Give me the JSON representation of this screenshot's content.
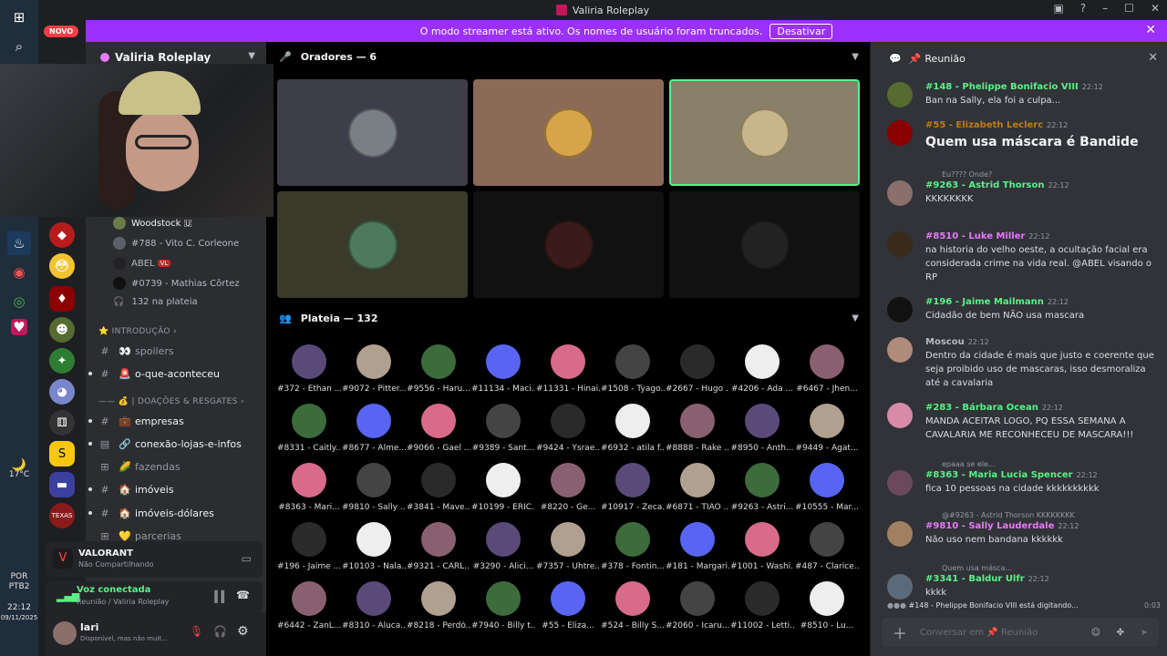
{
  "titlebar": {
    "title": "Valiria Roleplay"
  },
  "banner": {
    "text": "O modo streamer está ativo. Os nomes de usuário foram truncados.",
    "button": "Desativar"
  },
  "rail": {
    "new_badge": "NOVO"
  },
  "taskbar": {
    "temp": "17°C",
    "lang": "POR",
    "lang2": "PTB2",
    "time": "22:12",
    "date": "09/11/2025"
  },
  "server": {
    "name": "Valiria Roleplay"
  },
  "voice_users": [
    "Woodstock 🇺",
    "#788 - Vito C. Corleone",
    "ABEL",
    "#0739 - Mathias Côrtez"
  ],
  "voice_count": "132 na plateia",
  "categories": {
    "intro": "INTRODUÇÃO",
    "doacoes": "| DOAÇÕES & RESGATES"
  },
  "channels": [
    {
      "label": "spoilers",
      "emoji": "👀"
    },
    {
      "label": "o-que-aconteceu",
      "emoji": "🚨"
    },
    {
      "label": "empresas",
      "emoji": "💼"
    },
    {
      "label": "conexão-lojas-e-infos",
      "emoji": "🔗"
    },
    {
      "label": "fazendas",
      "emoji": "🌽"
    },
    {
      "label": "imóveis",
      "emoji": "🏠"
    },
    {
      "label": "imóveis-dólares",
      "emoji": "🏠"
    },
    {
      "label": "parcerias",
      "emoji": "💛"
    }
  ],
  "activity": {
    "title": "VALORANT",
    "sub": "Não Compartilhando"
  },
  "voice": {
    "status": "Voz conectada",
    "sub": "Reunião / Valiria Roleplay"
  },
  "user": {
    "name": "lari",
    "status": "Disponível, mas não muit..."
  },
  "stage": {
    "speakers_title": "Oradores — 6",
    "audience_title": "Plateia — 132"
  },
  "speakers": [
    {
      "bg": "#3e3d4a",
      "pic": "#7a7f86"
    },
    {
      "bg": "#8b6a57",
      "pic": "#d6a54a"
    },
    {
      "bg": "#8a7f68",
      "pic": "#c9b58a"
    },
    {
      "bg": "#3a3a2b",
      "pic": "#4d7a5c"
    },
    {
      "bg": "#111",
      "pic": "#3a1a1a"
    },
    {
      "bg": "#111",
      "pic": "#222"
    }
  ],
  "audience": [
    [
      "#372 - Ethan ...",
      "#9072 - Pitter...",
      "#9556 - Haru...",
      "#11134 - Maci...",
      "#11331 - Hinai...",
      "#1508 - Tyago...",
      "#2667 - Hugo ...",
      "#4206 - Ada ...",
      "#6467 - Jhen..."
    ],
    [
      "#8331 - Caitly...",
      "#8677 - Alme...",
      "#9066 - Gael ...",
      "#9389 - Sant...",
      "#9424 - Ysrae...",
      "#6932 - atila f...",
      "#8888 - Rake ...",
      "#8950 - Anth...",
      "#9449 - Agat..."
    ],
    [
      "#8363 - Mari...",
      "#9810 - Sally ...",
      "#3841 - Mave...",
      "#10199 - ERIC...",
      "#8220 - Ge...",
      "#10917 - Zeca...",
      "#6871 - TIAO ...",
      "#9263 - Astri...",
      "#10555 - Mar..."
    ],
    [
      "#196 - Jaime ...",
      "#10103 - Nala...",
      "#9321 - CARL...",
      "#3290 - Alici...",
      "#7357 - Uhtre...",
      "#378 - Fontin...",
      "#181 - Margari...",
      "#1001 - Washi...",
      "#487 - Clarice..."
    ],
    [
      "#6442 - ZanL...",
      "#8310 - Aluca...",
      "#8218 - Perdó...",
      "#7940 - Billy t...",
      "#55 - Eliza...",
      "#524 - Billy S...",
      "#2060 - Icaru...",
      "#11002 - Letti...",
      "#8510 - Lu..."
    ]
  ],
  "chat": {
    "title": "Reunião",
    "messages": [
      {
        "name": "#148 - Phelippe Bonifacio VIII",
        "time": "22:12",
        "text": "Ban na Sally, ela foi a culpa...",
        "color": "#57f287"
      },
      {
        "name": "#55 - Elizabeth Leclerc",
        "time": "22:12",
        "text": "Quem usa máscara é Bandide",
        "color": "#c27c0e"
      },
      {
        "reply": "Eu???? Onde?",
        "name": "#9263 - Astrid Thorson",
        "time": "22:12",
        "text": "KKKKKKKK",
        "color": "#57f287"
      },
      {
        "name": "#8510 - Luke Miller",
        "time": "22:12",
        "text": "na historia do velho oeste, a ocultação facial era considerada crime na vida real. @ABEL visando o RP",
        "color": "#e879f9"
      },
      {
        "name": "#196 - Jaime Mailmann",
        "time": "22:12",
        "text": "Cidadão de bem NÃO usa mascara",
        "color": "#57f287"
      },
      {
        "name": "Moscou",
        "time": "22:12",
        "text": "Dentro da cidade é mais que justo e coerente que seja proibido uso de mascaras, isso desmoraliza até a cavalaria",
        "color": "#b5bac1"
      },
      {
        "name": "#283 - Bárbara Ocean",
        "time": "22:12",
        "text": "MANDA ACEITAR LOGO, PQ ESSA SEMANA A CAVALARIA ME RECONHECEU DE MASCARA!!!",
        "color": "#57f287"
      },
      {
        "reply": "epaaa se ele...",
        "name": "#8363 - Maria Lucia Spencer",
        "time": "22:12",
        "text": "fica 10 pessoas na cidade kkkkkkkkkk",
        "color": "#57f287"
      },
      {
        "reply": "@#9263 - Astrid Thorson KKKKKKKK",
        "name": "#9810 - Sally Lauderdale",
        "time": "22:12",
        "text": "Não uso nem bandana kkkkkk",
        "color": "#e879f9"
      },
      {
        "reply": "Quem usa másca...",
        "name": "#3341 - Baldur Ulfr",
        "time": "22:12",
        "text": "kkkk",
        "color": "#57f287"
      }
    ],
    "typing": "#148 - Phelippe Bonifacio VIII está digitando...",
    "typing_time": "0:03",
    "placeholder": "Conversar em 📌 Reunião"
  }
}
